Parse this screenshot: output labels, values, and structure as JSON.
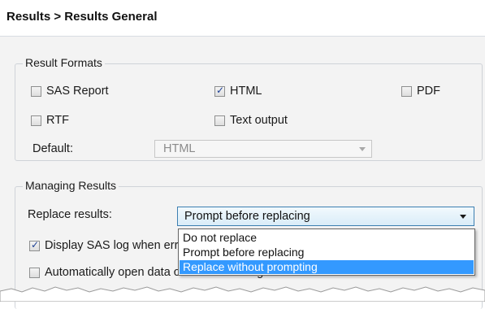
{
  "header": {
    "title": "Results > Results General"
  },
  "result_formats": {
    "legend": "Result Formats",
    "options": [
      {
        "label": "SAS Report",
        "checked": false
      },
      {
        "label": "HTML",
        "checked": true
      },
      {
        "label": "PDF",
        "checked": false
      },
      {
        "label": "RTF",
        "checked": false
      },
      {
        "label": "Text output",
        "checked": false
      }
    ],
    "default_label": "Default:",
    "default_value": "HTML"
  },
  "managing_results": {
    "legend": "Managing Results",
    "replace_label": "Replace results:",
    "replace_value": "Prompt before replacing",
    "dropdown_options": [
      {
        "label": "Do not replace",
        "highlighted": false
      },
      {
        "label": "Prompt before replacing",
        "highlighted": false
      },
      {
        "label": "Replace without prompting",
        "highlighted": true
      }
    ],
    "display_log": {
      "label": "Display SAS log when errors occur",
      "checked": true
    },
    "auto_open": {
      "label": "Automatically open data or results when generated",
      "checked": false
    }
  }
}
